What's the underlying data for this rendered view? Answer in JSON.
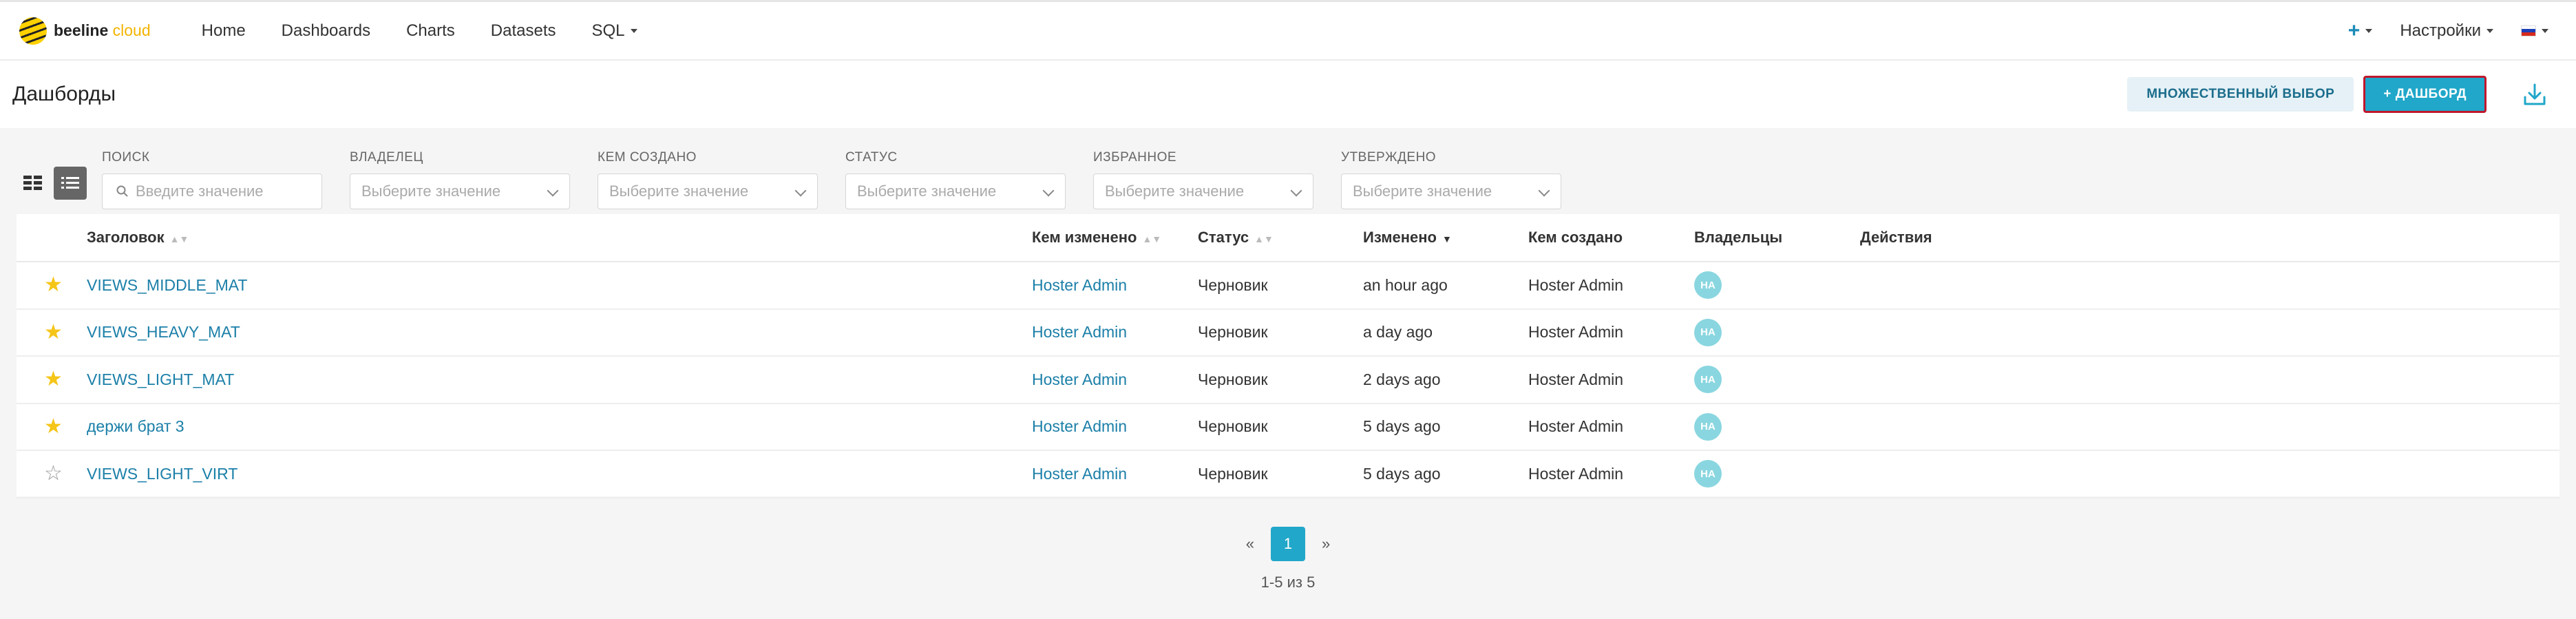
{
  "brand": {
    "name_part1": "beeline",
    "name_part2": " cloud"
  },
  "nav": [
    "Home",
    "Dashboards",
    "Charts",
    "Datasets",
    "SQL"
  ],
  "topbar_right": {
    "plus": "+",
    "settings": "Настройки"
  },
  "header": {
    "title": "Дашборды",
    "multi_select": "МНОЖЕСТВЕННЫЙ ВЫБОР",
    "new_dashboard": "+ ДАШБОРД"
  },
  "filters": {
    "search": {
      "label": "ПОИСК",
      "placeholder": "Введите значение"
    },
    "owner": {
      "label": "ВЛАДЕЛЕЦ",
      "placeholder": "Выберите значение"
    },
    "created_by": {
      "label": "КЕМ СОЗДАНО",
      "placeholder": "Выберите значение"
    },
    "status": {
      "label": "СТАТУС",
      "placeholder": "Выберите значение"
    },
    "favorite": {
      "label": "ИЗБРАННОЕ",
      "placeholder": "Выберите значение"
    },
    "certified": {
      "label": "УТВЕРЖДЕНО",
      "placeholder": "Выберите значение"
    }
  },
  "table": {
    "columns": {
      "title": "Заголовок",
      "changed_by": "Кем изменено",
      "status": "Статус",
      "changed": "Изменено",
      "created_by": "Кем создано",
      "owners": "Владельцы",
      "actions": "Действия"
    },
    "rows": [
      {
        "favorite": true,
        "title": "VIEWS_MIDDLE_MAT",
        "changed_by": "Hoster Admin",
        "status": "Черновик",
        "changed": "an hour ago",
        "created_by": "Hoster Admin",
        "owner": "HA"
      },
      {
        "favorite": true,
        "title": "VIEWS_HEAVY_MAT",
        "changed_by": "Hoster Admin",
        "status": "Черновик",
        "changed": "a day ago",
        "created_by": "Hoster Admin",
        "owner": "HA"
      },
      {
        "favorite": true,
        "title": "VIEWS_LIGHT_MAT",
        "changed_by": "Hoster Admin",
        "status": "Черновик",
        "changed": "2 days ago",
        "created_by": "Hoster Admin",
        "owner": "HA"
      },
      {
        "favorite": true,
        "title": "держи брат 3",
        "changed_by": "Hoster Admin",
        "status": "Черновик",
        "changed": "5 days ago",
        "created_by": "Hoster Admin",
        "owner": "HA"
      },
      {
        "favorite": false,
        "title": "VIEWS_LIGHT_VIRT",
        "changed_by": "Hoster Admin",
        "status": "Черновик",
        "changed": "5 days ago",
        "created_by": "Hoster Admin",
        "owner": "HA"
      }
    ]
  },
  "pagination": {
    "prev": "«",
    "current": "1",
    "next": "»",
    "info": "1-5 из 5"
  },
  "colors": {
    "accent": "#20a7c9",
    "link": "#1b7fa8",
    "star": "#f5c518",
    "primary_border": "#c0172d"
  }
}
